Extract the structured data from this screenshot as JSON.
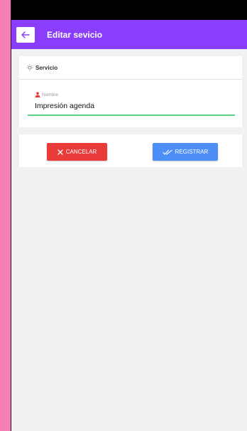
{
  "appbar": {
    "title": "Editar sevicio"
  },
  "card": {
    "header_label": "Servicio",
    "field": {
      "label": "Nombre",
      "value": "Impresión agenda"
    }
  },
  "actions": {
    "cancel_label": "CANCELAR",
    "register_label": "REGISTRAR"
  },
  "colors": {
    "appbar": "#8a3dfa",
    "cancel": "#ea3b3b",
    "register": "#4e8ef7",
    "underline": "#5ed081",
    "background": "#f77fb8"
  },
  "icons": [
    "arrow-left-icon",
    "lightbulb-icon",
    "person-icon",
    "close-icon",
    "double-check-icon"
  ]
}
